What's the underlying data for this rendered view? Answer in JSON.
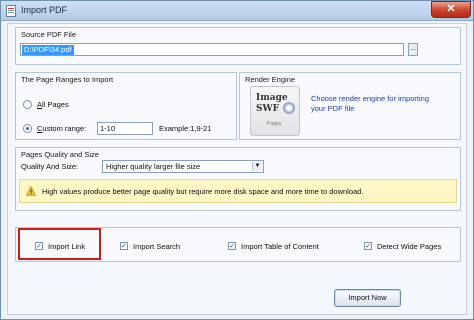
{
  "window": {
    "title": "Import PDF",
    "close_label": "✕"
  },
  "source": {
    "group_title": "Source PDF File",
    "path": "D:\\PDF\\34.pdf",
    "browse_label": "..."
  },
  "page_range": {
    "group_title": "The Page Ranges to Import",
    "all_pages_prefix": "A",
    "all_pages_rest": "ll Pages",
    "custom_prefix": "C",
    "custom_rest": "ustom range:",
    "custom_value": "1-10",
    "example": "Example:1,9-21",
    "selected": "custom range"
  },
  "render_engine": {
    "group_title": "Render Engine",
    "logo_line1": "Image",
    "logo_line2": "SWF",
    "logo_caption": "Pages",
    "link_text": "Choose render engine for importing your PDF file"
  },
  "quality": {
    "group_title": "Pages Quality and Size",
    "label": "Quality And Size:",
    "selected": "Higher quality larger file size",
    "warning": "High values produce better page quality but require more disk space and more time to download."
  },
  "options": [
    {
      "label": "Import Link",
      "checked": true
    },
    {
      "label": "Import Search",
      "checked": true
    },
    {
      "label": "Import Table of Content",
      "checked": true
    },
    {
      "label": "Detect Wide Pages",
      "checked": true
    }
  ],
  "footer": {
    "import_button": "Import Now"
  },
  "colors": {
    "highlight": "#d61a1a",
    "link": "#1f3fa8",
    "selection": "#3399ff"
  }
}
